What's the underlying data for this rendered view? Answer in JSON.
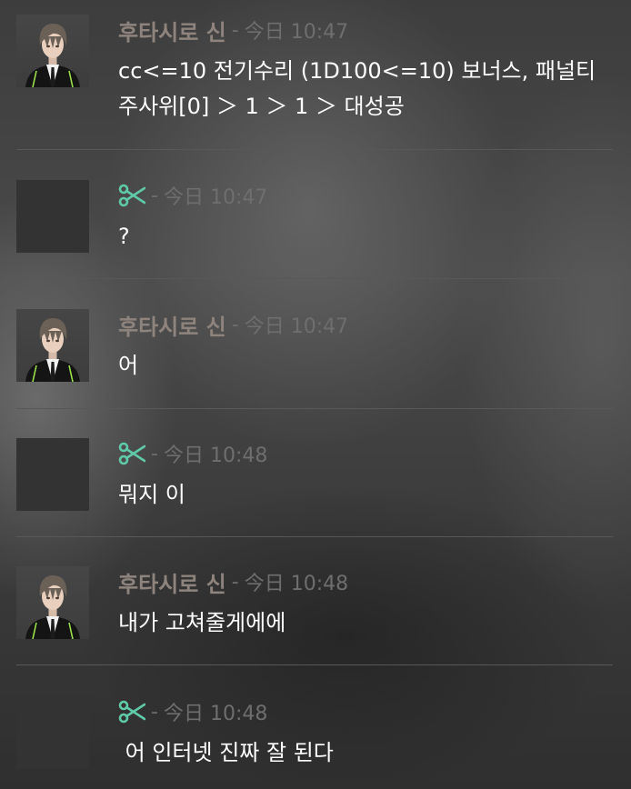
{
  "messages": [
    {
      "sender": "후타시로 신",
      "separator": "-",
      "time": "今日 10:47",
      "lines": [
        "cc<=10 전기수리 (1D100<=10) 보너스, 패널티",
        "주사위[0] ＞ 1 ＞ 1 ＞ 대성공"
      ],
      "avatar": "character-portrait"
    },
    {
      "sender_icon": "scissors-icon",
      "separator": "-",
      "time": "今日 10:47",
      "lines": [
        "?"
      ],
      "avatar": "blank"
    },
    {
      "sender": "후타시로 신",
      "separator": "-",
      "time": "今日 10:47",
      "lines": [
        "어"
      ],
      "avatar": "character-portrait"
    },
    {
      "sender_icon": "scissors-icon",
      "separator": "-",
      "time": "今日 10:48",
      "lines": [
        "뭐지 이"
      ],
      "avatar": "blank"
    },
    {
      "sender": "후타시로 신",
      "separator": "-",
      "time": "今日 10:48",
      "lines": [
        "내가 고쳐줄게에에"
      ],
      "avatar": "character-portrait"
    },
    {
      "sender_icon": "scissors-icon",
      "separator": "-",
      "time": "今日 10:48",
      "lines": [
        " 어 인터넷 진짜 잘 된다"
      ],
      "avatar": "blank"
    }
  ],
  "colors": {
    "sender_name": "#8e847d",
    "timestamp": "#6e6e6e",
    "message_text": "#ffffff",
    "scissors_icon": "#5fc9a8",
    "divider": "#585858"
  }
}
